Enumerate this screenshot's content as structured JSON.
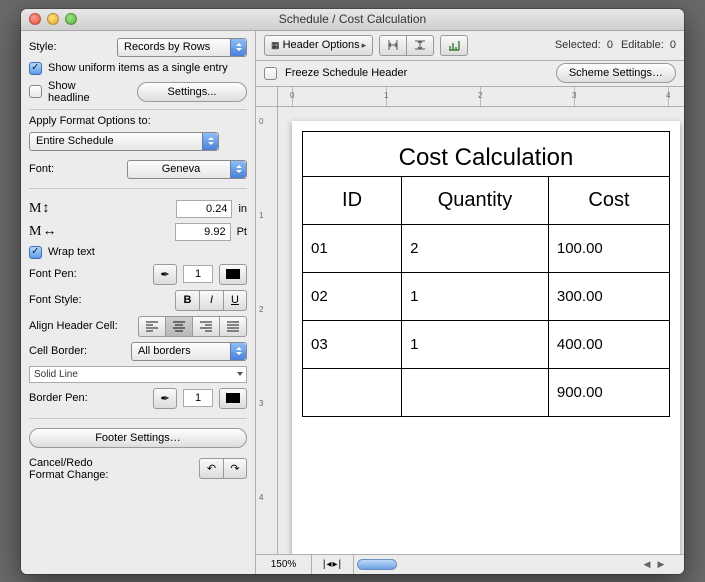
{
  "window": {
    "title": "Schedule /  Cost Calculation"
  },
  "sidebar": {
    "style_label": "Style:",
    "style_value": "Records by Rows",
    "show_uniform": "Show uniform items as a single entry",
    "show_uniform_checked": true,
    "show_headline": "Show headline",
    "show_headline_checked": false,
    "settings_btn": "Settings...",
    "apply_label": "Apply Format Options to:",
    "apply_value": "Entire Schedule",
    "font_label": "Font:",
    "font_value": "Geneva",
    "line_height_sym": "M↕",
    "line_height_val": "0.24",
    "line_height_unit": "in",
    "tracking_sym": "M↔",
    "tracking_val": "9.92",
    "tracking_unit": "Pt",
    "wrap_label": "Wrap text",
    "wrap_checked": true,
    "font_pen_label": "Font Pen:",
    "font_pen_val": "1",
    "font_style_label": "Font Style:",
    "b": "B",
    "i": "I",
    "u": "U",
    "align_label": "Align Header Cell:",
    "cell_border_label": "Cell Border:",
    "cell_border_val": "All borders",
    "line_style_val": "Solid Line",
    "border_pen_label": "Border Pen:",
    "border_pen_val": "1",
    "footer_btn": "Footer Settings…",
    "cancel_redo_label_1": "Cancel/Redo",
    "cancel_redo_label_2": "Format Change:"
  },
  "toolbar": {
    "header_options": "Header Options",
    "selected_label": "Selected:",
    "selected_val": "0",
    "editable_label": "Editable:",
    "editable_val": "0",
    "freeze_label": "Freeze Schedule Header",
    "scheme_btn": "Scheme Settings…"
  },
  "ruler": {
    "hnums": [
      "0",
      "1",
      "2",
      "3",
      "4"
    ],
    "vnums": [
      "0",
      "1",
      "2",
      "3",
      "4"
    ]
  },
  "zoom": "150%",
  "chart_data": {
    "type": "table",
    "title": "Cost Calculation",
    "columns": [
      "ID",
      "Quantity",
      "Cost"
    ],
    "rows": [
      {
        "id": "01",
        "qty": "2",
        "cost": "100.00"
      },
      {
        "id": "02",
        "qty": "1",
        "cost": "300.00"
      },
      {
        "id": "03",
        "qty": "1",
        "cost": "400.00"
      }
    ],
    "total_cost": "900.00"
  }
}
